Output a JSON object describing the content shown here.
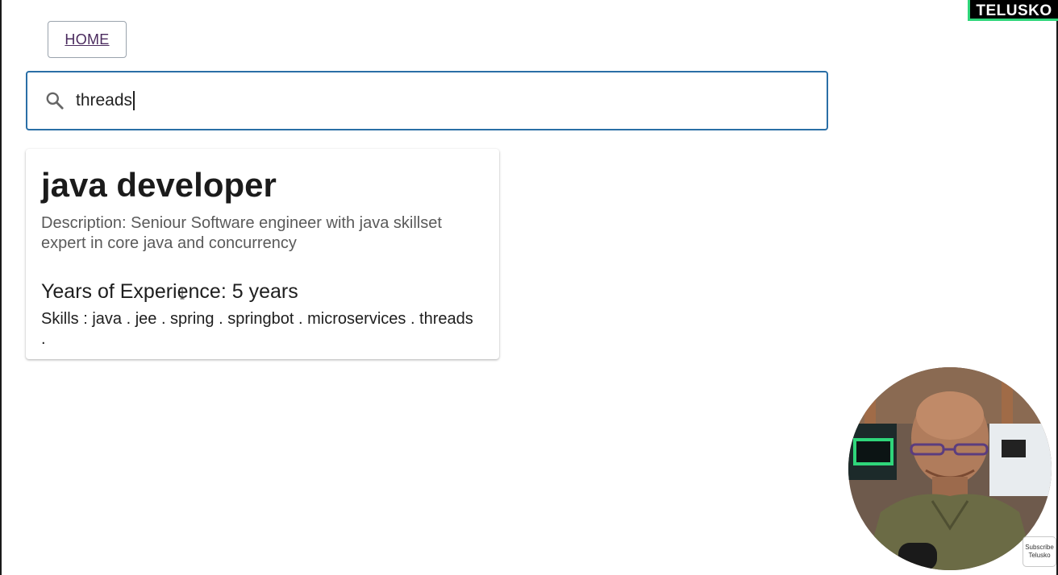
{
  "nav": {
    "home_label": "HOME"
  },
  "search": {
    "value": "threads",
    "icon": "search-icon"
  },
  "job_post": {
    "title": "java developer",
    "description": "Description: Seniour Software engineer with java skillset expert in core java and concurrency",
    "experience": "Years of Experience: 5 years",
    "skills": "Skills : java . jee . spring . springbot . microservices . threads ."
  },
  "brand": {
    "logo_text": "TELUSKO"
  },
  "overlay": {
    "subscribe_line1": "Subscribe",
    "subscribe_line2": "Telusko"
  },
  "colors": {
    "search_border": "#2a6fa6",
    "home_link": "#4a2a5e",
    "brand_accent": "#2fd67a"
  }
}
